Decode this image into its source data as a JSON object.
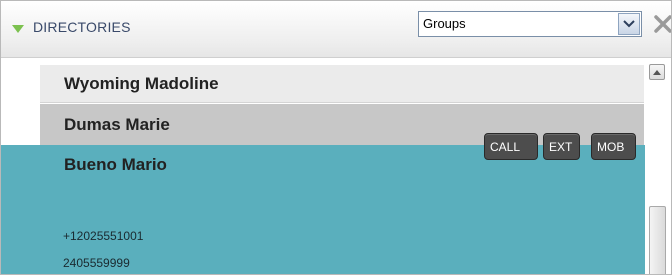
{
  "header": {
    "title": "DIRECTORIES",
    "group_select": {
      "value": "Groups"
    }
  },
  "contacts": [
    {
      "name": "Wyoming Madoline"
    },
    {
      "name": "Dumas Marie"
    },
    {
      "name": "Bueno Mario",
      "actions": {
        "call": "CALL",
        "ext": "EXT",
        "mob": "MOB"
      },
      "phones": [
        "+12025551001",
        "2405559999"
      ]
    }
  ],
  "colors": {
    "accent_arrow": "#7cc14f",
    "selected_row": "#5aafbd",
    "hover_row": "#c7c7c7",
    "row_bg": "#ebebeb",
    "action_button": "#4d4d4d"
  },
  "icons": {
    "collapse": "triangle-down-icon",
    "dropdown": "chevron-down-icon",
    "close": "close-icon",
    "scroll_up": "arrow-up-icon"
  }
}
